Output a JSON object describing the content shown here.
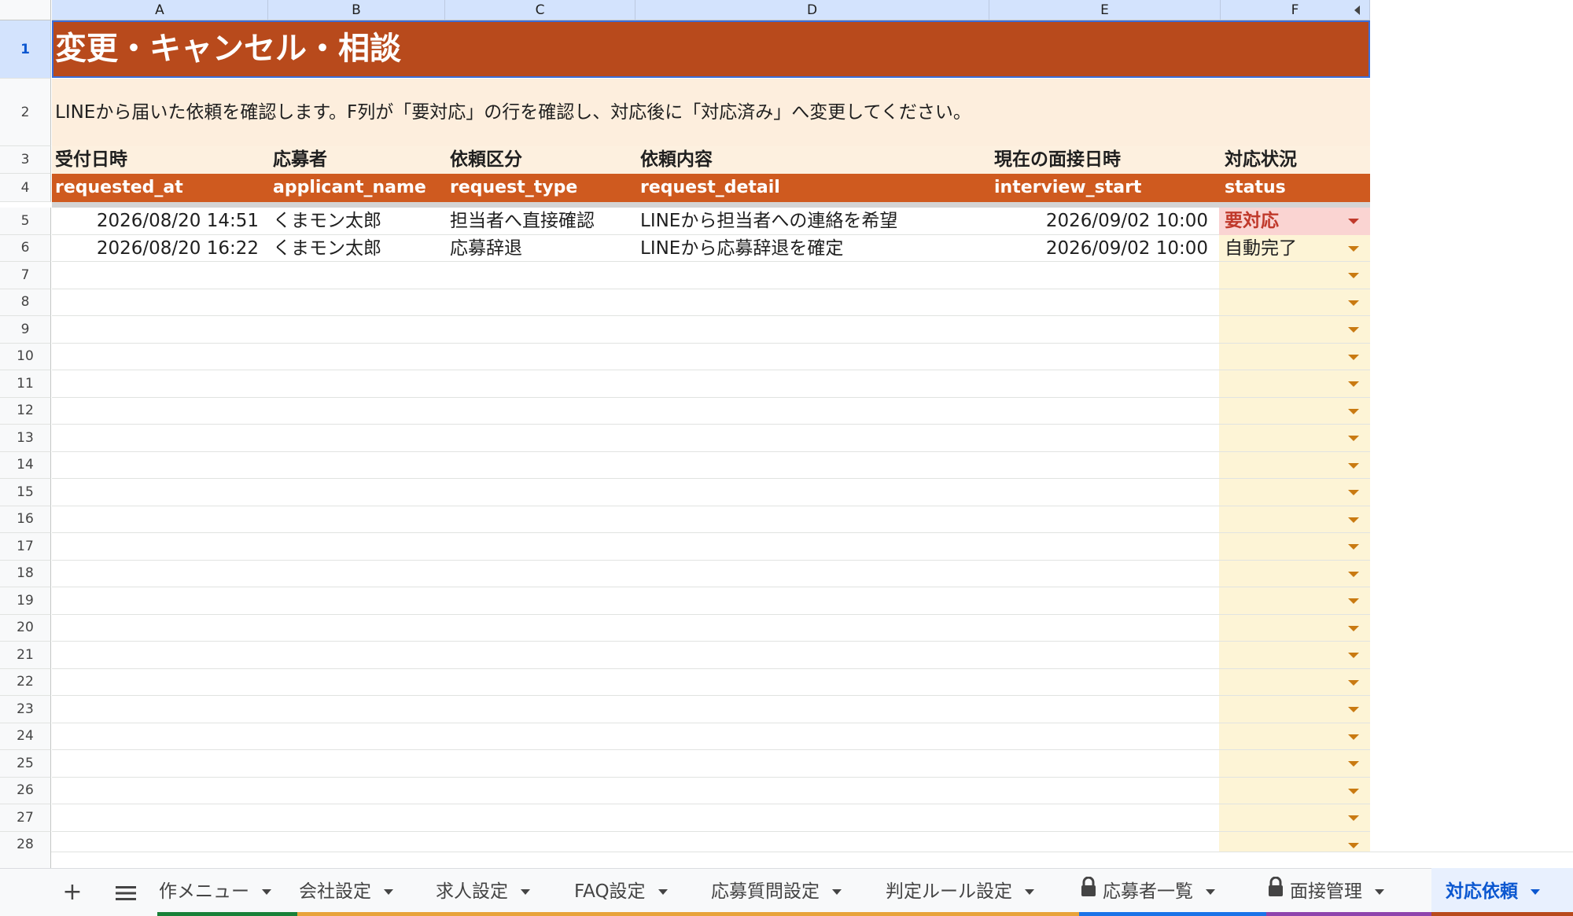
{
  "sheet": {
    "columns": [
      "A",
      "B",
      "C",
      "D",
      "E",
      "F"
    ],
    "row_numbers": [
      "1",
      "2",
      "3",
      "4",
      "5",
      "6",
      "7",
      "8",
      "9",
      "10",
      "11",
      "12",
      "13",
      "14",
      "15",
      "16",
      "17",
      "18",
      "19",
      "20",
      "21",
      "22",
      "23",
      "24",
      "25",
      "26",
      "27",
      "28"
    ],
    "title": "変更・キャンセル・相談",
    "description": "LINEから届いた依頼を確認します。F列が「要対応」の行を確認し、対応後に「対応済み」へ変更してください。",
    "jp_headers": [
      "受付日時",
      "応募者",
      "依頼区分",
      "依頼内容",
      "現在の面接日時",
      "対応状況"
    ],
    "key_headers": [
      "requested_at",
      "applicant_name",
      "request_type",
      "request_detail",
      "interview_start",
      "status"
    ],
    "rows": [
      {
        "requested_at": "2026/08/20 14:51",
        "applicant_name": "くまモン太郎",
        "request_type": "担当者へ直接確認",
        "request_detail": "LINEから担当者への連絡を希望",
        "interview_start": "2026/09/02 10:00",
        "status": "要対応"
      },
      {
        "requested_at": "2026/08/20 16:22",
        "applicant_name": "くまモン太郎",
        "request_type": "応募辞退",
        "request_detail": "LINEから応募辞退を確定",
        "interview_start": "2026/09/02 10:00",
        "status": "自動完了"
      }
    ]
  },
  "colors": {
    "title_bg": "#b84a1c",
    "key_header_bg": "#cf5a1f",
    "description_bg": "#fdeedd",
    "status_col_bg": "#fdf4d6",
    "urgent_bg": "#fad4d2",
    "urgent_text": "#c0392b",
    "active_tab": "#0b57d0"
  },
  "tabs": {
    "add_icon": "plus-icon",
    "all_sheets_icon": "menu-icon",
    "items": [
      {
        "label": "作メニュー",
        "locked": false,
        "accent": "#188038"
      },
      {
        "label": "会社設定",
        "locked": false,
        "accent": "#e8a33a"
      },
      {
        "label": "求人設定",
        "locked": false,
        "accent": "#e8a33a"
      },
      {
        "label": "FAQ設定",
        "locked": false,
        "accent": "#e8a33a"
      },
      {
        "label": "応募質問設定",
        "locked": false,
        "accent": "#e8a33a"
      },
      {
        "label": "判定ルール設定",
        "locked": false,
        "accent": "#e8a33a"
      },
      {
        "label": "応募者一覧",
        "locked": true,
        "accent": "#1a73e8"
      },
      {
        "label": "面接管理",
        "locked": true,
        "accent": "#8e44ad"
      },
      {
        "label": "対応依頼",
        "locked": false,
        "accent": "#b84a1c",
        "active": true
      }
    ]
  }
}
